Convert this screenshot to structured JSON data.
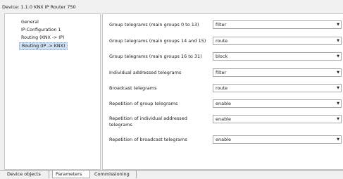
{
  "window": {
    "title": "Device: 1.1.0  KNX IP Router 750"
  },
  "nav": {
    "items": [
      {
        "label": "General"
      },
      {
        "label": "IP-Configuration 1"
      },
      {
        "label": "Routing (KNX -> IP)"
      },
      {
        "label": "Routing (IP -> KNX)",
        "selected": true
      }
    ]
  },
  "parameters": [
    {
      "label": "Group telegrams (main groups 0 to 13)",
      "value": "filter"
    },
    {
      "label": "Group telegrams (main groups 14 and 15)",
      "value": "route"
    },
    {
      "label": "Group telegrams (main groups 16 to 31)",
      "value": "block"
    },
    {
      "label": "Individual addressed telegrams",
      "value": "filter"
    },
    {
      "label": "Broadcast telegrams",
      "value": "route"
    },
    {
      "label": "Repetition of group telegrams",
      "value": "enable"
    },
    {
      "label": "Repetition of individual addressed telegrams",
      "value": "enable"
    },
    {
      "label": "Repetition of broadcast telegrams",
      "value": "enable"
    }
  ],
  "tabs": [
    {
      "label": "Device objects"
    },
    {
      "label": "Parameters",
      "active": true
    },
    {
      "label": "Commissioning"
    }
  ],
  "icons": {
    "dropdown": "chevron-down-icon"
  }
}
